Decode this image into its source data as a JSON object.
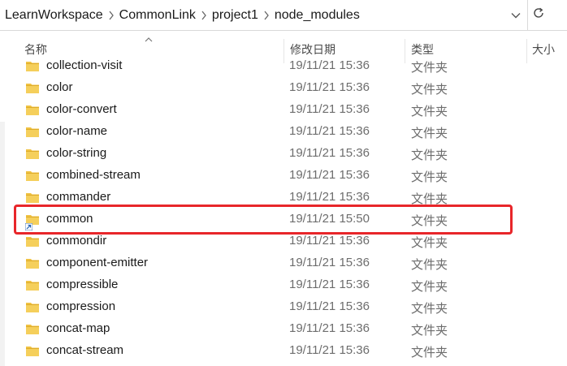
{
  "address": {
    "crumbs": [
      "LearnWorkspace",
      "CommonLink",
      "project1",
      "node_modules"
    ]
  },
  "columns": {
    "name": "名称",
    "date": "修改日期",
    "type": "类型",
    "size": "大小"
  },
  "rows": [
    {
      "name": "collection-visit",
      "date": "19/11/21 15:36",
      "type": "文件夹",
      "shortcut": false
    },
    {
      "name": "color",
      "date": "19/11/21 15:36",
      "type": "文件夹",
      "shortcut": false
    },
    {
      "name": "color-convert",
      "date": "19/11/21 15:36",
      "type": "文件夹",
      "shortcut": false
    },
    {
      "name": "color-name",
      "date": "19/11/21 15:36",
      "type": "文件夹",
      "shortcut": false
    },
    {
      "name": "color-string",
      "date": "19/11/21 15:36",
      "type": "文件夹",
      "shortcut": false
    },
    {
      "name": "combined-stream",
      "date": "19/11/21 15:36",
      "type": "文件夹",
      "shortcut": false
    },
    {
      "name": "commander",
      "date": "19/11/21 15:36",
      "type": "文件夹",
      "shortcut": false
    },
    {
      "name": "common",
      "date": "19/11/21 15:50",
      "type": "文件夹",
      "shortcut": true
    },
    {
      "name": "commondir",
      "date": "19/11/21 15:36",
      "type": "文件夹",
      "shortcut": false
    },
    {
      "name": "component-emitter",
      "date": "19/11/21 15:36",
      "type": "文件夹",
      "shortcut": false
    },
    {
      "name": "compressible",
      "date": "19/11/21 15:36",
      "type": "文件夹",
      "shortcut": false
    },
    {
      "name": "compression",
      "date": "19/11/21 15:36",
      "type": "文件夹",
      "shortcut": false
    },
    {
      "name": "concat-map",
      "date": "19/11/21 15:36",
      "type": "文件夹",
      "shortcut": false
    },
    {
      "name": "concat-stream",
      "date": "19/11/21 15:36",
      "type": "文件夹",
      "shortcut": false
    }
  ],
  "colors": {
    "folder": "#f0c243",
    "folder_dark": "#d9a521",
    "highlight": "#e8262a",
    "shortcut_arrow": "#1f5fb5"
  },
  "icons": {
    "folder": "folder-icon",
    "shortcut": "shortcut-arrow-icon",
    "refresh": "refresh-icon",
    "dropdown": "chevron-down-icon",
    "separator": "chevron-right-icon",
    "sort": "sort-up-icon"
  }
}
